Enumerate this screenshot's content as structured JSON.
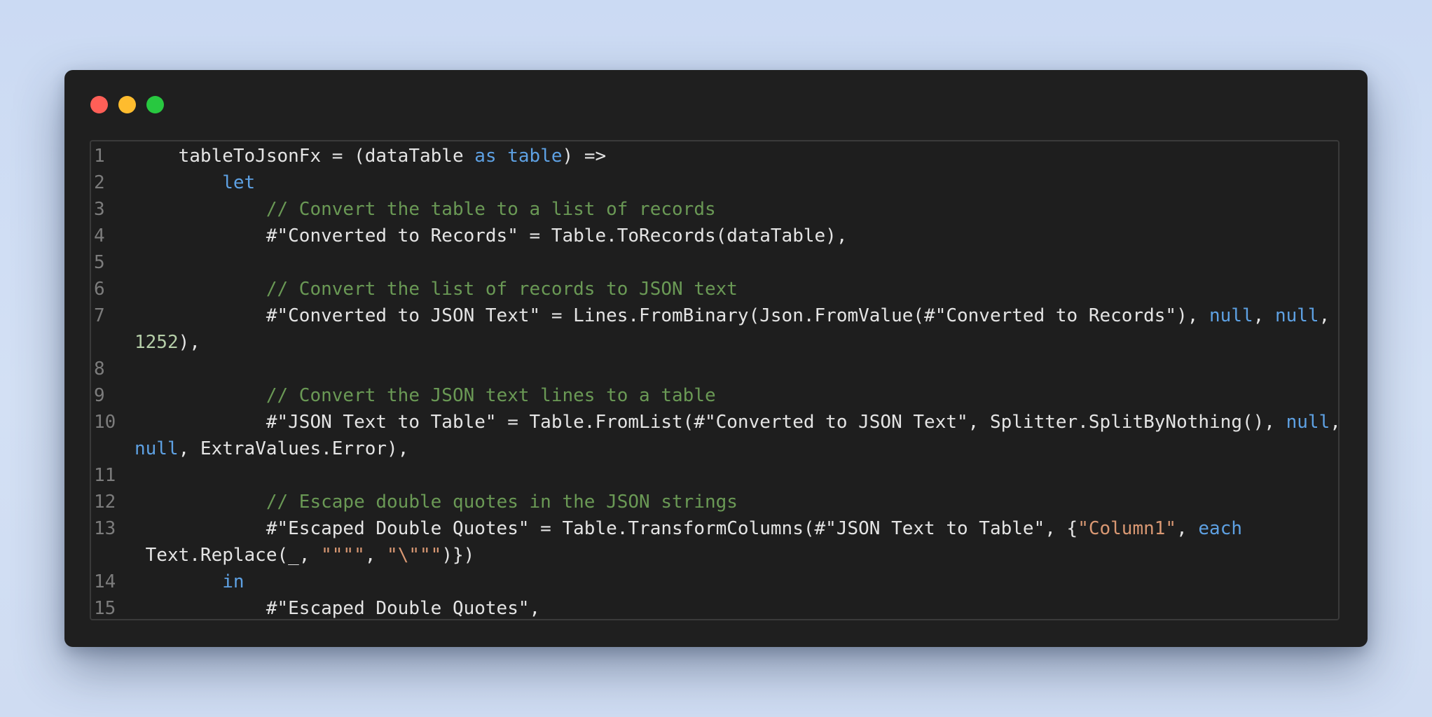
{
  "window": {
    "controls": [
      {
        "name": "close-control",
        "color": "#ff5f57"
      },
      {
        "name": "minimize-control",
        "color": "#febc2e"
      },
      {
        "name": "maximize-control",
        "color": "#28c840"
      }
    ]
  },
  "colors": {
    "background": "#cbdaf3",
    "window": "#1f1f1f",
    "keyword": "#5ea1e3",
    "comment": "#6a9955",
    "string": "#d99873",
    "number": "#b5cea8",
    "text": "#e4e4e4",
    "line_number": "#7c7c7c"
  },
  "code": {
    "lines": [
      {
        "number": "1",
        "tokens": [
          {
            "t": "    tableToJsonFx = (dataTable "
          },
          {
            "t": "as",
            "k": "kw"
          },
          {
            "t": " "
          },
          {
            "t": "table",
            "k": "kw"
          },
          {
            "t": ") =>"
          }
        ]
      },
      {
        "number": "2",
        "tokens": [
          {
            "t": "        "
          },
          {
            "t": "let",
            "k": "kw"
          }
        ]
      },
      {
        "number": "3",
        "tokens": [
          {
            "t": "            "
          },
          {
            "t": "// Convert the table to a list of records",
            "k": "cm"
          }
        ]
      },
      {
        "number": "4",
        "tokens": [
          {
            "t": "            #\"Converted to Records\" = Table.ToRecords(dataTable),"
          }
        ]
      },
      {
        "number": "5",
        "tokens": []
      },
      {
        "number": "6",
        "tokens": [
          {
            "t": "            "
          },
          {
            "t": "// Convert the list of records to JSON text",
            "k": "cm"
          }
        ]
      },
      {
        "number": "7",
        "tokens": [
          {
            "t": "            #\"Converted to JSON Text\" = Lines.FromBinary(Json.FromValue(#\"Converted to Records\"), "
          },
          {
            "t": "null",
            "k": "kw"
          },
          {
            "t": ", "
          },
          {
            "t": "null",
            "k": "kw"
          },
          {
            "t": ","
          }
        ]
      },
      {
        "number": "",
        "tokens": [
          {
            "t": "1252",
            "k": "num"
          },
          {
            "t": "),"
          }
        ]
      },
      {
        "number": "8",
        "tokens": []
      },
      {
        "number": "9",
        "tokens": [
          {
            "t": "            "
          },
          {
            "t": "// Convert the JSON text lines to a table",
            "k": "cm"
          }
        ]
      },
      {
        "number": "10",
        "tokens": [
          {
            "t": "            #\"JSON Text to Table\" = Table.FromList(#\"Converted to JSON Text\", Splitter.SplitByNothing(), "
          },
          {
            "t": "null",
            "k": "kw"
          },
          {
            "t": ","
          }
        ]
      },
      {
        "number": "",
        "tokens": [
          {
            "t": "null",
            "k": "kw"
          },
          {
            "t": ", ExtraValues.Error),"
          }
        ]
      },
      {
        "number": "11",
        "tokens": []
      },
      {
        "number": "12",
        "tokens": [
          {
            "t": "            "
          },
          {
            "t": "// Escape double quotes in the JSON strings",
            "k": "cm"
          }
        ]
      },
      {
        "number": "13",
        "tokens": [
          {
            "t": "            #\"Escaped Double Quotes\" = Table.TransformColumns(#\"JSON Text to Table\", {"
          },
          {
            "t": "\"Column1\"",
            "k": "str"
          },
          {
            "t": ", "
          },
          {
            "t": "each",
            "k": "kw"
          }
        ]
      },
      {
        "number": "",
        "tokens": [
          {
            "t": " Text.Replace(_, "
          },
          {
            "t": "\"\"\"\"",
            "k": "str"
          },
          {
            "t": ", "
          },
          {
            "t": "\"\\\"\"\"",
            "k": "str"
          },
          {
            "t": ")})"
          }
        ]
      },
      {
        "number": "14",
        "tokens": [
          {
            "t": "        "
          },
          {
            "t": "in",
            "k": "kw"
          }
        ]
      },
      {
        "number": "15",
        "tokens": [
          {
            "t": "            #\"Escaped Double Quotes\","
          }
        ]
      }
    ]
  }
}
